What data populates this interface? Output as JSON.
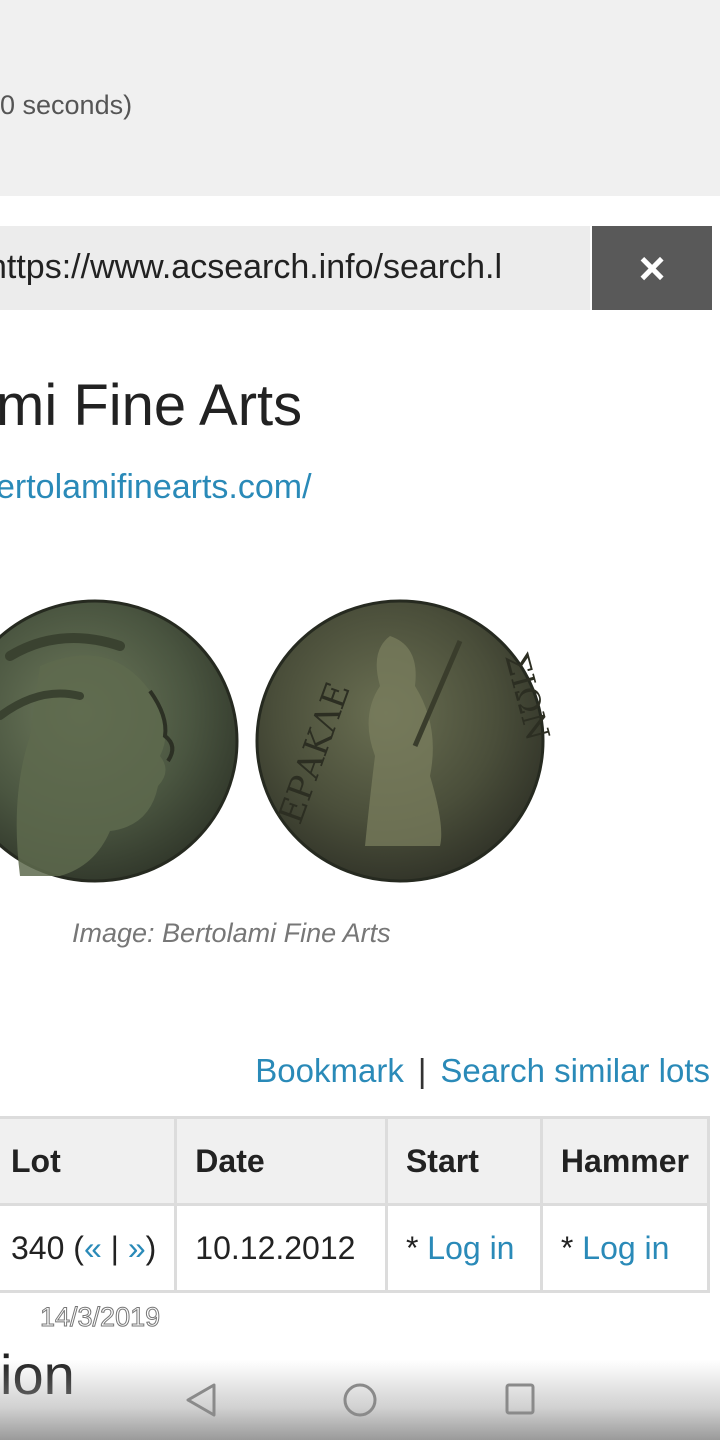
{
  "search_timing": "0 seconds)",
  "url_bar": {
    "value": "https://www.acsearch.info/search.l",
    "close_label": "×"
  },
  "auction_house": {
    "name": "mi Fine Arts",
    "link": "ertolamifinearts.com/"
  },
  "image_caption": "Image: Bertolami Fine Arts",
  "actions": {
    "bookmark": "Bookmark",
    "separator": "|",
    "search_similar": "Search similar lots"
  },
  "lot_table": {
    "headers": [
      "Lot",
      "Date",
      "Start",
      "Hammer"
    ],
    "row": {
      "lot_number": "340 (",
      "prev": "«",
      "divider": " | ",
      "next": "»",
      "lot_close": ")",
      "date": "10.12.2012",
      "start_prefix": "* ",
      "start_link": "Log in",
      "hammer_prefix": "* ",
      "hammer_link": "Log in"
    }
  },
  "watermark_date": "14/3/2019",
  "section_heading_partial": "ion",
  "system_nav": {
    "back": "back-icon",
    "home": "home-icon",
    "recents": "recents-icon"
  }
}
